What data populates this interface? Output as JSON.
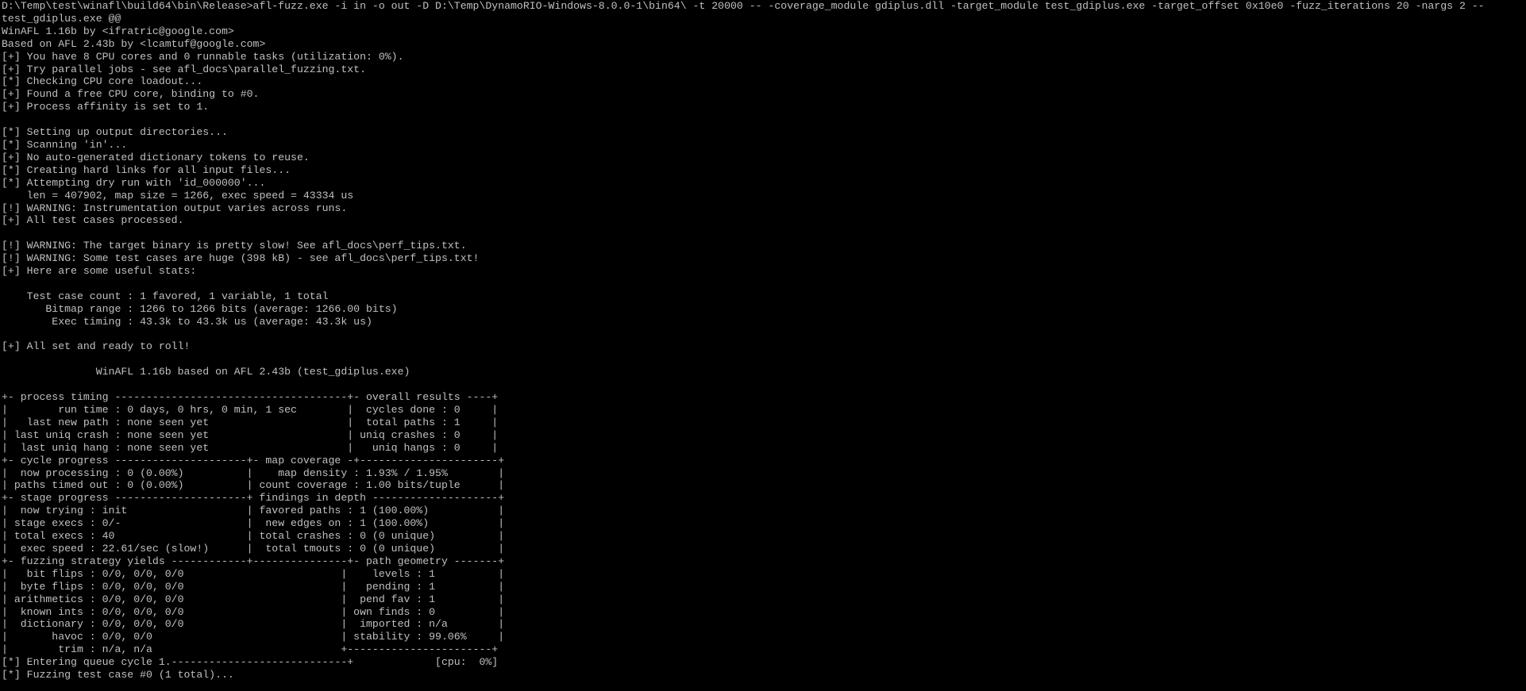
{
  "colors": {
    "background": "#000000",
    "text": "#c0c0c0"
  },
  "console": {
    "lines": [
      "D:\\Temp\\test\\winafl\\build64\\bin\\Release>afl-fuzz.exe -i in -o out -D D:\\Temp\\DynamoRIO-Windows-8.0.0-1\\bin64\\ -t 20000 -- -coverage_module gdiplus.dll -target_module test_gdiplus.exe -target_offset 0x10e0 -fuzz_iterations 20 -nargs 2 --",
      "test_gdiplus.exe @@",
      "WinAFL 1.16b by <ifratric@google.com>",
      "Based on AFL 2.43b by <lcamtuf@google.com>",
      "[+] You have 8 CPU cores and 0 runnable tasks (utilization: 0%).",
      "[+] Try parallel jobs - see afl_docs\\parallel_fuzzing.txt.",
      "[*] Checking CPU core loadout...",
      "[+] Found a free CPU core, binding to #0.",
      "[+] Process affinity is set to 1.",
      "",
      "[*] Setting up output directories...",
      "[*] Scanning 'in'...",
      "[+] No auto-generated dictionary tokens to reuse.",
      "[*] Creating hard links for all input files...",
      "[*] Attempting dry run with 'id_000000'...",
      "    len = 407902, map size = 1266, exec speed = 43334 us",
      "[!] WARNING: Instrumentation output varies across runs.",
      "[+] All test cases processed.",
      "",
      "[!] WARNING: The target binary is pretty slow! See afl_docs\\perf_tips.txt.",
      "[!] WARNING: Some test cases are huge (398 kB) - see afl_docs\\perf_tips.txt!",
      "[+] Here are some useful stats:",
      "",
      "    Test case count : 1 favored, 1 variable, 1 total",
      "       Bitmap range : 1266 to 1266 bits (average: 1266.00 bits)",
      "        Exec timing : 43.3k to 43.3k us (average: 43.3k us)",
      "",
      "[+] All set and ready to roll!",
      "",
      "               WinAFL 1.16b based on AFL 2.43b (test_gdiplus.exe)",
      "",
      "+- process timing -------------------------------------+- overall results ----+",
      "|        run time : 0 days, 0 hrs, 0 min, 1 sec        |  cycles done : 0     |",
      "|   last new path : none seen yet                      |  total paths : 1     |",
      "| last uniq crash : none seen yet                      | uniq crashes : 0     |",
      "|  last uniq hang : none seen yet                      |   uniq hangs : 0     |",
      "+- cycle progress ---------------------+- map coverage -+----------------------+",
      "|  now processing : 0 (0.00%)          |    map density : 1.93% / 1.95%        |",
      "| paths timed out : 0 (0.00%)          | count coverage : 1.00 bits/tuple      |",
      "+- stage progress ---------------------+ findings in depth --------------------+",
      "|  now trying : init                   | favored paths : 1 (100.00%)           |",
      "| stage execs : 0/-                    |  new edges on : 1 (100.00%)           |",
      "| total execs : 40                     | total crashes : 0 (0 unique)          |",
      "|  exec speed : 22.61/sec (slow!)      |  total tmouts : 0 (0 unique)          |",
      "+- fuzzing strategy yields ------------+---------------+- path geometry -------+",
      "|   bit flips : 0/0, 0/0, 0/0                         |    levels : 1          |",
      "|  byte flips : 0/0, 0/0, 0/0                         |   pending : 1          |",
      "| arithmetics : 0/0, 0/0, 0/0                         |  pend fav : 1          |",
      "|  known ints : 0/0, 0/0, 0/0                         | own finds : 0          |",
      "|  dictionary : 0/0, 0/0, 0/0                         |  imported : n/a        |",
      "|       havoc : 0/0, 0/0                              | stability : 99.06%     |",
      "|        trim : n/a, n/a                              +-----------------------+",
      "[*] Entering queue cycle 1.----------------------------+             [cpu:  0%]",
      "[*] Fuzzing test case #0 (1 total)..."
    ]
  }
}
